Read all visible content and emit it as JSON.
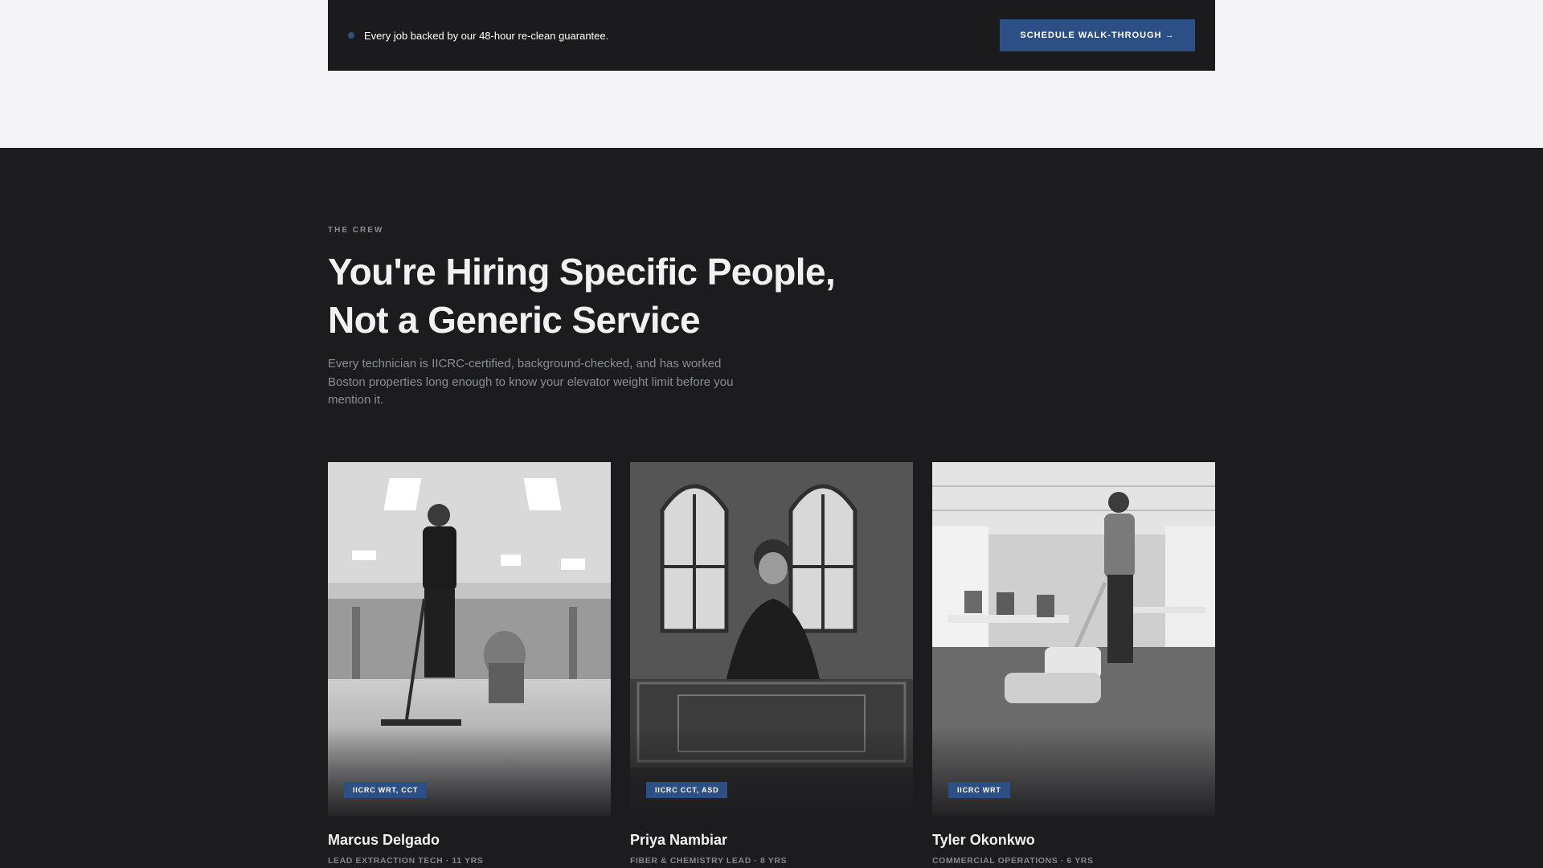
{
  "banner": {
    "guarantee_text": "Every job backed by our 48-hour re-clean guarantee.",
    "cta_label": "SCHEDULE WALK-THROUGH →",
    "accent_color": "#2c4f86"
  },
  "crew": {
    "eyebrow": "THE CREW",
    "headline": "You're Hiring Specific People, Not a Generic Service",
    "lede": "Every technician is IICRC-certified, background-checked, and has worked Boston properties long enough to know your elevator weight limit before you mention it.",
    "members": [
      {
        "name": "Marcus Delgado",
        "certs": "IICRC WRT, CCT",
        "role": "LEAD EXTRACTION TECH · 11 YRS",
        "photo_icon": "technician-extraction-photo"
      },
      {
        "name": "Priya Nambiar",
        "certs": "IICRC CCT, ASD",
        "role": "FIBER & CHEMISTRY LEAD · 8 YRS",
        "photo_icon": "technician-rug-photo"
      },
      {
        "name": "Tyler Okonkwo",
        "certs": "IICRC WRT",
        "role": "COMMERCIAL OPERATIONS · 6 YRS",
        "photo_icon": "technician-office-photo"
      }
    ]
  }
}
